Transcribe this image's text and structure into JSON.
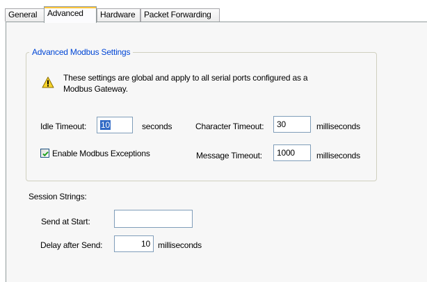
{
  "tabs": [
    {
      "label": "General",
      "active": false
    },
    {
      "label": "Advanced",
      "active": true
    },
    {
      "label": "Hardware",
      "active": false
    },
    {
      "label": "Packet Forwarding",
      "active": false
    }
  ],
  "advanced_modbus": {
    "group_title": "Advanced Modbus Settings",
    "notice_line1": "These settings are global and apply to all serial ports configured as a",
    "notice_line2": "Modbus Gateway.",
    "idle_timeout_label": "Idle Timeout:",
    "idle_timeout_value": "10",
    "idle_timeout_unit": "seconds",
    "character_timeout_label": "Character Timeout:",
    "character_timeout_value": "30",
    "character_timeout_unit": "milliseconds",
    "enable_exceptions_label": "Enable Modbus Exceptions",
    "enable_exceptions_checked": true,
    "message_timeout_label": "Message Timeout:",
    "message_timeout_value": "1000",
    "message_timeout_unit": "milliseconds"
  },
  "session_strings": {
    "heading": "Session Strings:",
    "send_at_start_label": "Send at Start:",
    "send_at_start_value": "",
    "delay_after_send_label": "Delay after Send:",
    "delay_after_send_value": "10",
    "delay_after_send_unit": "milliseconds"
  },
  "colors": {
    "group_title": "#0046d5",
    "panel_background": "#f7f7f7",
    "active_tab_highlight": "#ffc73c",
    "selection": "#316ac5"
  },
  "icons": {
    "notice": "warning-icon",
    "checkbox_mark": "checkmark-icon"
  }
}
